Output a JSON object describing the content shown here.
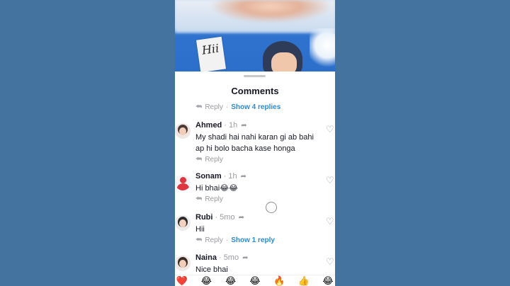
{
  "video": {
    "sign_text": "Hii"
  },
  "comments_panel": {
    "title": "Comments",
    "top_reply_row": {
      "reply_label": "Reply",
      "separator": "·",
      "show_replies_label": "Show 4 replies"
    },
    "comments": [
      {
        "author": "Ahmed",
        "time": "· 1h",
        "text": "My shadi hai nahi karan gi ab bahi ap hi bolo bacha kase honga",
        "reply_label": "Reply",
        "show_replies_label": ""
      },
      {
        "author": "Sonam",
        "time": "· 1h",
        "text": "Hi bhai😂😂",
        "reply_label": "Reply",
        "show_replies_label": ""
      },
      {
        "author": "Rubi",
        "time": "· 5mo",
        "text": "Hii",
        "reply_label": "Reply",
        "show_replies_label": "Show 1 reply"
      },
      {
        "author": "Naina",
        "time": "· 5mo",
        "text": "Nice bhai",
        "reply_label": "",
        "show_replies_label": ""
      }
    ],
    "icons": {
      "reply": "reply-arrow-icon",
      "share": "share-arrow-icon",
      "like": "heart-outline-icon"
    },
    "quick_emojis": [
      "❤️",
      "😂",
      "😂",
      "😂",
      "🔥",
      "👍",
      "😂"
    ]
  },
  "colors": {
    "background": "#45739f",
    "link": "#2a8bd5",
    "muted": "#9a9aa0",
    "text": "#161823"
  }
}
